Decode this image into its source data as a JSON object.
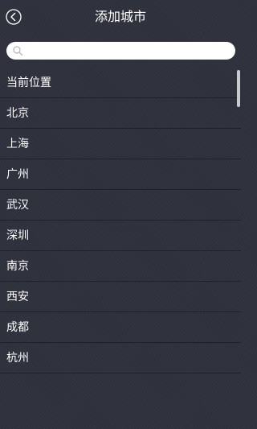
{
  "header": {
    "title": "添加城市",
    "back_icon": "chevron-left-circle-icon"
  },
  "search": {
    "placeholder": "",
    "value": "",
    "icon": "search-icon"
  },
  "cities": [
    {
      "label": "当前位置"
    },
    {
      "label": "北京"
    },
    {
      "label": "上海"
    },
    {
      "label": "广州"
    },
    {
      "label": "武汉"
    },
    {
      "label": "深圳"
    },
    {
      "label": "南京"
    },
    {
      "label": "西安"
    },
    {
      "label": "成都"
    },
    {
      "label": "杭州"
    }
  ],
  "colors": {
    "background": "#2f323d",
    "divider": "#1f2128",
    "text": "#ffffff",
    "search_bg": "#ffffff",
    "scrollbar": "#c9cbd0"
  }
}
